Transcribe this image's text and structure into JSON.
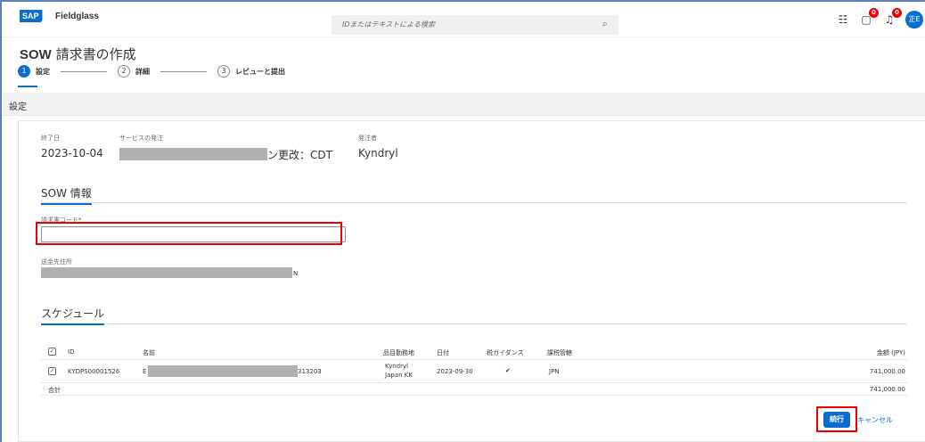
{
  "shell": {
    "brand": "SAP",
    "product": "Fieldglass",
    "search_placeholder": "IDまたはテキストによる検索",
    "notification_count": "0",
    "task_count": "0",
    "avatar_initials": "正E"
  },
  "page": {
    "title_prefix": "SOW",
    "title_rest": " 請求書の作成"
  },
  "wizard": {
    "steps": [
      {
        "num": "1",
        "label": "設定"
      },
      {
        "num": "2",
        "label": "詳細"
      },
      {
        "num": "3",
        "label": "レビューと提出"
      }
    ]
  },
  "section": {
    "title": "設定"
  },
  "summary": {
    "end_date_label": "終了日",
    "end_date": "2023-10-04",
    "service_order_label": "サービスの発注",
    "service_order_suffix": "ン更改：CDT",
    "orderer_label": "発注者",
    "orderer": "Kyndryl"
  },
  "sow_info": {
    "heading": "SOW 情報",
    "invoice_code_label": "請求書コード",
    "required_mark": "*",
    "invoice_code_value": "",
    "remit_to_label": "送金先住所",
    "remit_to_suffix": "N"
  },
  "schedule": {
    "heading": "スケジュール",
    "columns": {
      "id": "ID",
      "name": "名前",
      "location": "品目勤務地",
      "date": "日付",
      "tax_guidance": "税ガイダンス",
      "tax_jurisdiction": "課税管轄",
      "amount": "金額 (JPY)"
    },
    "rows": [
      {
        "id": "KYDPS00001526",
        "name_prefix": "E",
        "name_suffix": "313203",
        "location_line1": "Kyndryl",
        "location_line2": "Japan KK",
        "date": "2023-09-30",
        "tax_guidance": "✔",
        "tax_jurisdiction": "JPN",
        "amount": "741,000.00"
      }
    ],
    "total_label": "合計",
    "total_amount": "741,000.00"
  },
  "actions": {
    "continue_label": "続行",
    "cancel_label": "キャンセル"
  }
}
